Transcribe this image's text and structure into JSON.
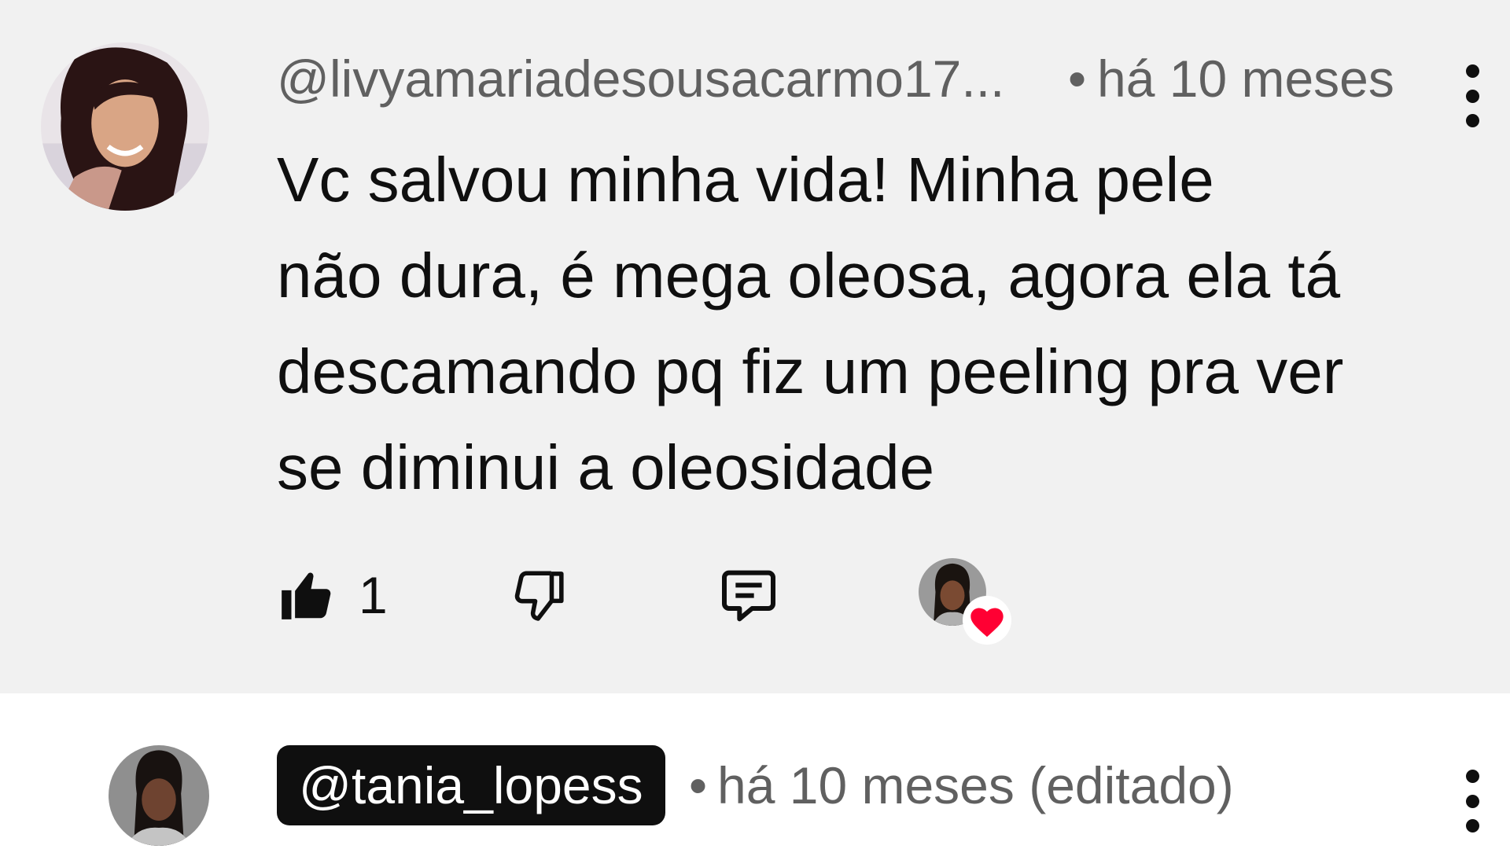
{
  "comment_main": {
    "handle": "@livyamariadesousacarmo17...",
    "separator": "•",
    "time": "há 10 meses",
    "text_lines": [
      "Vc salvou minha vida! Minha pele",
      "não dura, é mega oleosa, agora ela tá",
      "descamando pq fiz um peeling pra ver",
      "se diminui a oleosidade"
    ],
    "like_count": "1",
    "icons": {
      "like": "thumbs-up-filled-icon",
      "dislike": "thumbs-down-icon",
      "reply": "comment-icon",
      "heart": "heart-icon",
      "more": "more-vertical-icon"
    }
  },
  "comment_second": {
    "handle": "@tania_lopess",
    "separator": "•",
    "time": "há 10 meses (editado)"
  },
  "colors": {
    "highlight_bg": "#f1f1f1",
    "text": "#0f0f0f",
    "meta_text": "#606060",
    "heart": "#ff0033",
    "pill_bg": "#0f0f0f"
  }
}
